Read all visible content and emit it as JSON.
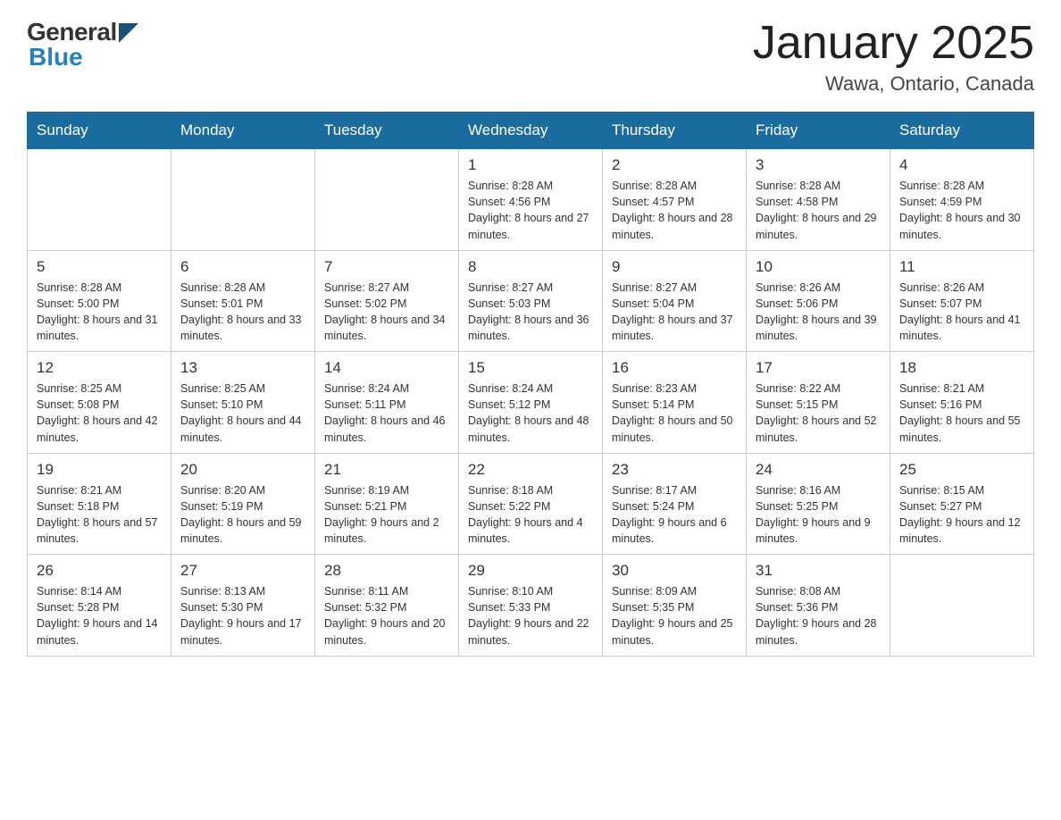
{
  "header": {
    "logo_general": "General",
    "logo_blue": "Blue",
    "month_title": "January 2025",
    "location": "Wawa, Ontario, Canada"
  },
  "weekdays": [
    "Sunday",
    "Monday",
    "Tuesday",
    "Wednesday",
    "Thursday",
    "Friday",
    "Saturday"
  ],
  "weeks": [
    [
      {
        "day": "",
        "info": ""
      },
      {
        "day": "",
        "info": ""
      },
      {
        "day": "",
        "info": ""
      },
      {
        "day": "1",
        "info": "Sunrise: 8:28 AM\nSunset: 4:56 PM\nDaylight: 8 hours\nand 27 minutes."
      },
      {
        "day": "2",
        "info": "Sunrise: 8:28 AM\nSunset: 4:57 PM\nDaylight: 8 hours\nand 28 minutes."
      },
      {
        "day": "3",
        "info": "Sunrise: 8:28 AM\nSunset: 4:58 PM\nDaylight: 8 hours\nand 29 minutes."
      },
      {
        "day": "4",
        "info": "Sunrise: 8:28 AM\nSunset: 4:59 PM\nDaylight: 8 hours\nand 30 minutes."
      }
    ],
    [
      {
        "day": "5",
        "info": "Sunrise: 8:28 AM\nSunset: 5:00 PM\nDaylight: 8 hours\nand 31 minutes."
      },
      {
        "day": "6",
        "info": "Sunrise: 8:28 AM\nSunset: 5:01 PM\nDaylight: 8 hours\nand 33 minutes."
      },
      {
        "day": "7",
        "info": "Sunrise: 8:27 AM\nSunset: 5:02 PM\nDaylight: 8 hours\nand 34 minutes."
      },
      {
        "day": "8",
        "info": "Sunrise: 8:27 AM\nSunset: 5:03 PM\nDaylight: 8 hours\nand 36 minutes."
      },
      {
        "day": "9",
        "info": "Sunrise: 8:27 AM\nSunset: 5:04 PM\nDaylight: 8 hours\nand 37 minutes."
      },
      {
        "day": "10",
        "info": "Sunrise: 8:26 AM\nSunset: 5:06 PM\nDaylight: 8 hours\nand 39 minutes."
      },
      {
        "day": "11",
        "info": "Sunrise: 8:26 AM\nSunset: 5:07 PM\nDaylight: 8 hours\nand 41 minutes."
      }
    ],
    [
      {
        "day": "12",
        "info": "Sunrise: 8:25 AM\nSunset: 5:08 PM\nDaylight: 8 hours\nand 42 minutes."
      },
      {
        "day": "13",
        "info": "Sunrise: 8:25 AM\nSunset: 5:10 PM\nDaylight: 8 hours\nand 44 minutes."
      },
      {
        "day": "14",
        "info": "Sunrise: 8:24 AM\nSunset: 5:11 PM\nDaylight: 8 hours\nand 46 minutes."
      },
      {
        "day": "15",
        "info": "Sunrise: 8:24 AM\nSunset: 5:12 PM\nDaylight: 8 hours\nand 48 minutes."
      },
      {
        "day": "16",
        "info": "Sunrise: 8:23 AM\nSunset: 5:14 PM\nDaylight: 8 hours\nand 50 minutes."
      },
      {
        "day": "17",
        "info": "Sunrise: 8:22 AM\nSunset: 5:15 PM\nDaylight: 8 hours\nand 52 minutes."
      },
      {
        "day": "18",
        "info": "Sunrise: 8:21 AM\nSunset: 5:16 PM\nDaylight: 8 hours\nand 55 minutes."
      }
    ],
    [
      {
        "day": "19",
        "info": "Sunrise: 8:21 AM\nSunset: 5:18 PM\nDaylight: 8 hours\nand 57 minutes."
      },
      {
        "day": "20",
        "info": "Sunrise: 8:20 AM\nSunset: 5:19 PM\nDaylight: 8 hours\nand 59 minutes."
      },
      {
        "day": "21",
        "info": "Sunrise: 8:19 AM\nSunset: 5:21 PM\nDaylight: 9 hours\nand 2 minutes."
      },
      {
        "day": "22",
        "info": "Sunrise: 8:18 AM\nSunset: 5:22 PM\nDaylight: 9 hours\nand 4 minutes."
      },
      {
        "day": "23",
        "info": "Sunrise: 8:17 AM\nSunset: 5:24 PM\nDaylight: 9 hours\nand 6 minutes."
      },
      {
        "day": "24",
        "info": "Sunrise: 8:16 AM\nSunset: 5:25 PM\nDaylight: 9 hours\nand 9 minutes."
      },
      {
        "day": "25",
        "info": "Sunrise: 8:15 AM\nSunset: 5:27 PM\nDaylight: 9 hours\nand 12 minutes."
      }
    ],
    [
      {
        "day": "26",
        "info": "Sunrise: 8:14 AM\nSunset: 5:28 PM\nDaylight: 9 hours\nand 14 minutes."
      },
      {
        "day": "27",
        "info": "Sunrise: 8:13 AM\nSunset: 5:30 PM\nDaylight: 9 hours\nand 17 minutes."
      },
      {
        "day": "28",
        "info": "Sunrise: 8:11 AM\nSunset: 5:32 PM\nDaylight: 9 hours\nand 20 minutes."
      },
      {
        "day": "29",
        "info": "Sunrise: 8:10 AM\nSunset: 5:33 PM\nDaylight: 9 hours\nand 22 minutes."
      },
      {
        "day": "30",
        "info": "Sunrise: 8:09 AM\nSunset: 5:35 PM\nDaylight: 9 hours\nand 25 minutes."
      },
      {
        "day": "31",
        "info": "Sunrise: 8:08 AM\nSunset: 5:36 PM\nDaylight: 9 hours\nand 28 minutes."
      },
      {
        "day": "",
        "info": ""
      }
    ]
  ]
}
